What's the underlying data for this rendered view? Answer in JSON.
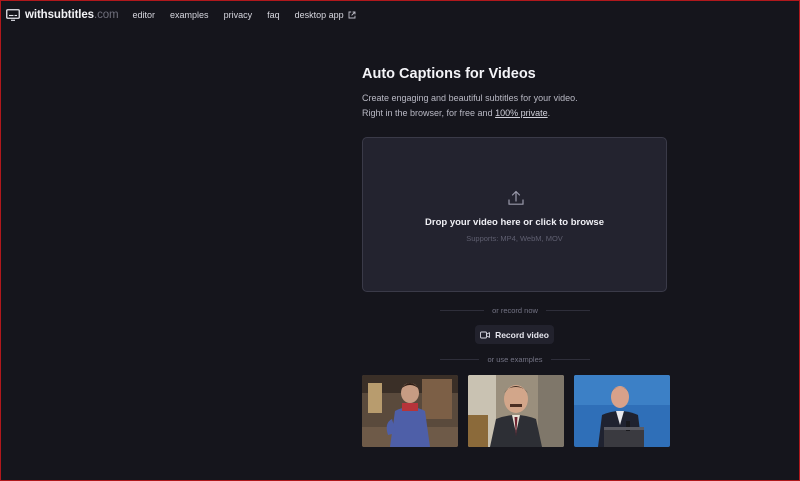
{
  "nav": {
    "logo_main": "withsubtitles",
    "logo_domain": ".com",
    "links": [
      "editor",
      "examples",
      "privacy",
      "faq",
      "desktop app"
    ],
    "external_icon": "external-link-icon"
  },
  "hero": {
    "title": "Auto Captions for Videos",
    "subtitle_line1": "Create engaging and beautiful subtitles for your video.",
    "subtitle_line2_prefix": "Right in the browser, for free and ",
    "subtitle_private_link": "100% private",
    "subtitle_line2_suffix": "."
  },
  "dropzone": {
    "icon": "upload-icon",
    "text": "Drop your video here or click to browse",
    "supports": "Supports: MP4, WebM, MOV"
  },
  "record": {
    "divider": "or record now",
    "button_label": "Record video",
    "icon": "video-camera-icon"
  },
  "examples": {
    "divider": "or use examples",
    "items": [
      "example-video-1",
      "example-video-2",
      "example-video-3"
    ]
  },
  "colors": {
    "background": "#15151c",
    "dropzone": "#23232f",
    "border_frame": "#b0181c"
  }
}
